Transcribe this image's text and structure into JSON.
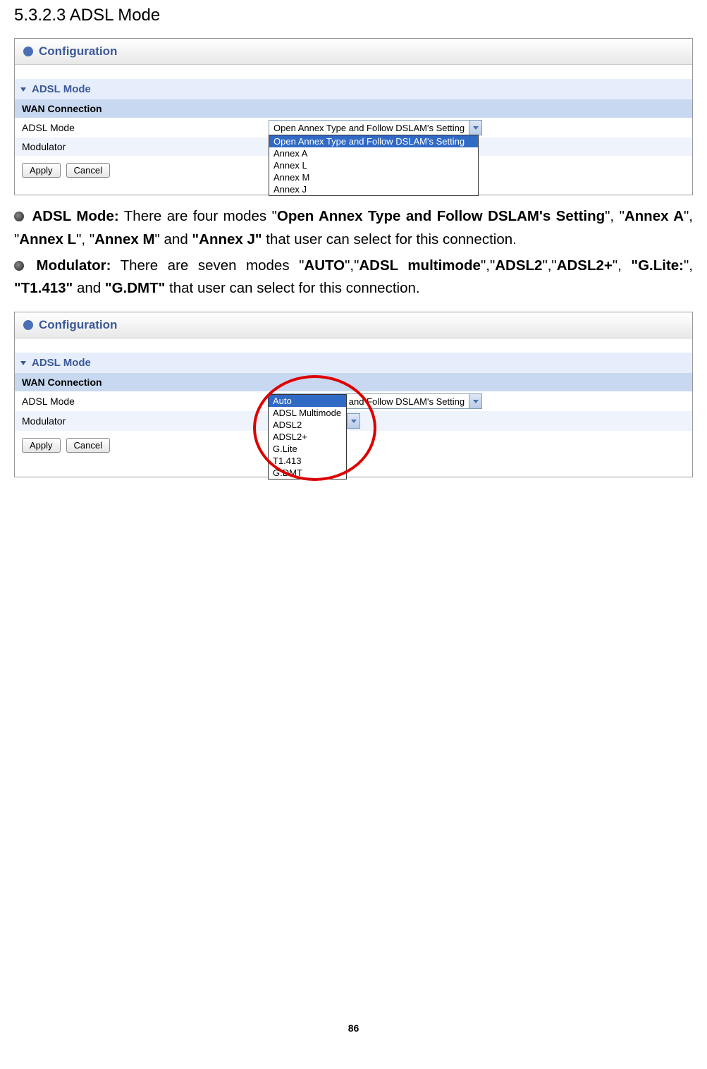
{
  "section_heading": "5.3.2.3 ADSL Mode",
  "panel1": {
    "title": "Configuration",
    "subheader": "ADSL Mode",
    "wan_header": "WAN Connection",
    "adsl_mode_label": "ADSL Mode",
    "modulator_label": "Modulator",
    "adsl_mode_value": "Open Annex Type and Follow DSLAM's Setting",
    "dropdown_options": [
      "Open Annex Type and Follow DSLAM's Setting",
      "Annex A",
      "Annex L",
      "Annex M",
      "Annex J"
    ],
    "apply_label": "Apply",
    "cancel_label": "Cancel"
  },
  "desc1": {
    "label": "ADSL Mode:",
    "pre": " There are four modes \"",
    "b1": "Open Annex Type and Follow DSLAM's Setting",
    "m1": "\", \"",
    "b2": "Annex A",
    "m2": "\", \"",
    "b3": "Annex L",
    "m3": "\",  \"",
    "b4": "Annex M",
    "m4": "\" and ",
    "b5": "\"Annex J\"",
    "post": " that user can select for this connection."
  },
  "desc2": {
    "label": "Modulator:",
    "pre": " There are seven modes \"",
    "b1": "AUTO",
    "m1": "\",\"",
    "b2": "ADSL multimode",
    "m2": "\",\"",
    "b3": "ADSL2",
    "m3": "\",\"",
    "b4": "ADSL2+",
    "m4": "\", ",
    "b5": "\"G.Lite:",
    "m5": "\", ",
    "b6": "\"T1.413\"",
    "m6": " and ",
    "b7": "\"G.DMT\"",
    "post": " that user can select for this connection."
  },
  "panel2": {
    "title": "Configuration",
    "subheader": "ADSL Mode",
    "wan_header": "WAN Connection",
    "adsl_mode_label": "ADSL Mode",
    "modulator_label": "Modulator",
    "adsl_mode_value": "Open Annex Type and Follow DSLAM's Setting",
    "modulator_value": "Auto",
    "dropdown_options": [
      "Auto",
      "ADSL Multimode",
      "ADSL2",
      "ADSL2+",
      "G.Lite",
      "T1.413",
      "G.DMT"
    ],
    "apply_label": "Apply",
    "cancel_label": "Cancel"
  },
  "page_number": "86"
}
